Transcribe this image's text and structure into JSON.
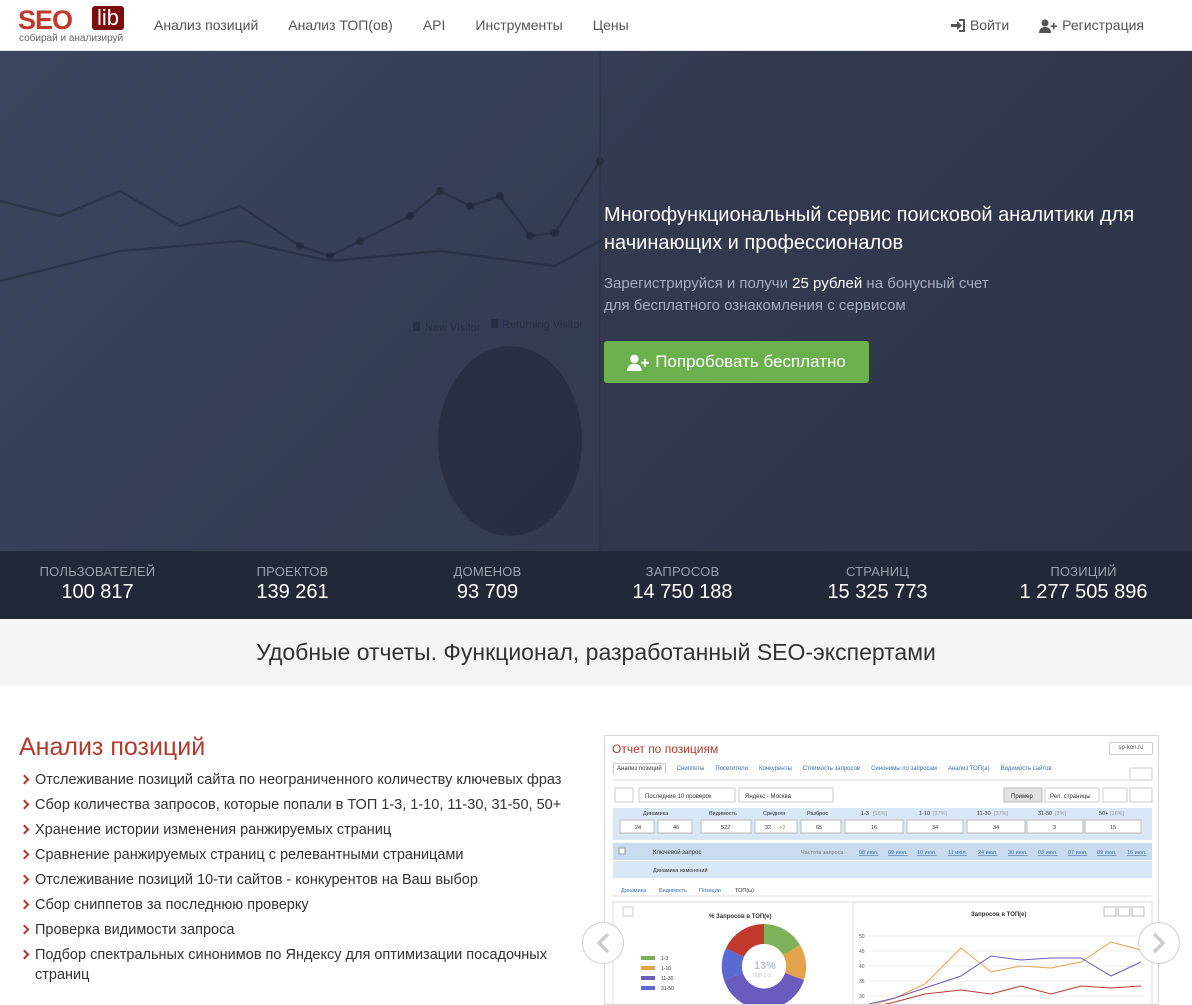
{
  "logo": {
    "seo": "SEO",
    "lib": "lib",
    "tagline": "собирай и анализируй"
  },
  "nav": {
    "items": [
      {
        "label": "Анализ позиций"
      },
      {
        "label": "Анализ ТОП(ов)"
      },
      {
        "label": "API"
      },
      {
        "label": "Инструменты"
      },
      {
        "label": "Цены"
      }
    ],
    "login": "Войти",
    "register": "Регистрация"
  },
  "hero": {
    "title": "Многофункциональный сервис поисковой аналитики для начинающих и профессионалов",
    "sub_before": "Зарегистрируйся и получи ",
    "sub_bold": "25 рублей",
    "sub_after": " на бонусный счет",
    "sub_line2": "для бесплатного ознакомления с сервисом",
    "cta": "Попробовать бесплатно",
    "bg_legend_1": "New Visitor",
    "bg_legend_2": "Returning Visitor"
  },
  "stats": [
    {
      "label": "ПОЛЬЗОВАТЕЛЕЙ",
      "value": "100 817"
    },
    {
      "label": "ПРОЕКТОВ",
      "value": "139 261"
    },
    {
      "label": "ДОМЕНОВ",
      "value": "93 709"
    },
    {
      "label": "ЗАПРОСОВ",
      "value": "14 750 188"
    },
    {
      "label": "СТРАНИЦ",
      "value": "15 325 773"
    },
    {
      "label": "ПОЗИЦИЙ",
      "value": "1 277 505 896"
    }
  ],
  "band_title": "Удобные отчеты. Функционал, разработанный SEO-экспертами",
  "features": {
    "title": "Анализ позиций",
    "items": [
      "Отслеживание позиций сайта по неограниченного количеству ключевых фраз",
      "Сбор количества запросов, которые попали в ТОП 1-3, 1-10, 11-30, 31-50, 50+",
      "Хранение истории изменения ранжируемых страниц",
      "Сравнение ранжируемых страниц с релевантными страницами",
      "Отслеживание позиций 10-ти сайтов - конкурентов на Ваш выбор",
      "Сбор сниппетов за последнюю проверку",
      "Проверка видимости запроса",
      "Подбор спектральных синонимов по Яндексу для оптимизации посадочных страниц"
    ]
  },
  "screenshot": {
    "title": "Отчет по позициям",
    "site": "sp-kon.ru",
    "tabs": [
      "Анализ позиций",
      "Сниппеты",
      "Посетители",
      "Конкуренты",
      "Стоимость запросов",
      "Синонимы по запросам",
      "Анализ ТОП(а)",
      "Видимость сайтов"
    ],
    "filter": "Последние 10 проверок",
    "engine": "Яндекс - Москва",
    "btn_primary": "Пример",
    "btn_pages": "Рел. страницы",
    "metrics_head": [
      "Динамика",
      "Видимость",
      "Средняя",
      "Разброс",
      "1-3",
      "1-10",
      "11-30",
      "31-50",
      "50+"
    ],
    "metrics_pct": [
      "[16%]",
      "[37%]",
      "[37%]",
      "[3%]",
      "[16%]"
    ],
    "metrics_val": [
      "24",
      "46",
      "522",
      "32",
      "+2",
      "65",
      "16",
      "34",
      "34",
      "3",
      "15"
    ],
    "col_query": "Ключевой запрос",
    "col_freq": "Частота запроса",
    "dates": [
      "08 июл.",
      "09 июл.",
      "10 июл.",
      "11 июл.",
      "24 июл.",
      "30 июл.",
      "03 июл.",
      "07 июл.",
      "09 июл.",
      "16 июл."
    ],
    "dyn_label": "Динамика изменений",
    "sub_tabs": [
      "Динамика",
      "Видимость",
      "Позиции",
      "ТОП(ы)"
    ],
    "donut_title": "% Запросов в ТОП(е)",
    "donut_center": "13%",
    "donut_center_sub": "ТОП 1-3",
    "donut_legend": [
      "1-3",
      "1-10",
      "11-30",
      "31-50"
    ],
    "line_title": "Запросов в ТОП(е)",
    "line_ticks": [
      "50",
      "45",
      "40",
      "35",
      "30"
    ]
  }
}
